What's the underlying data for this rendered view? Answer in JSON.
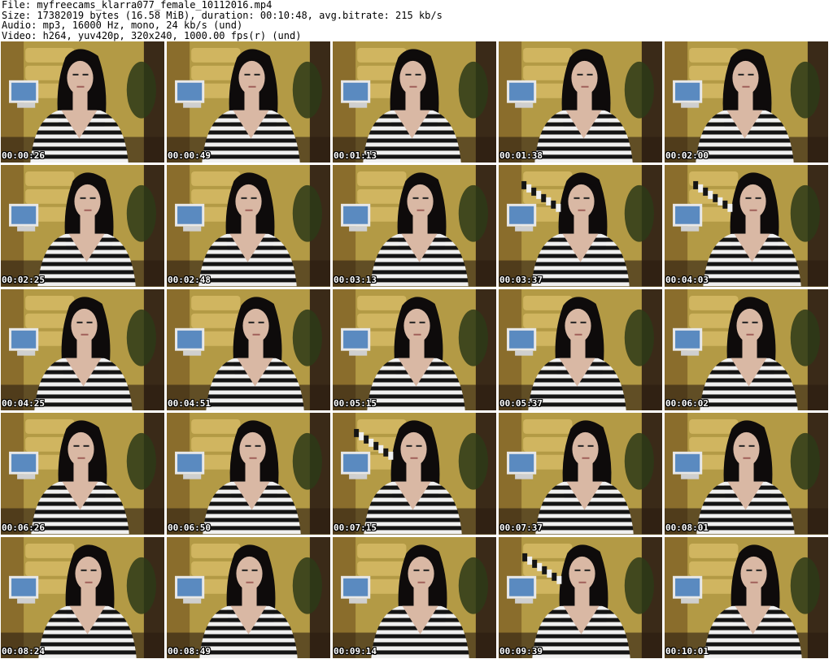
{
  "header": {
    "file_line": "File: myfreecams_klarra077_female_10112016.mp4",
    "size_line": "Size: 17382019 bytes (16.58 MiB), duration: 00:10:48, avg.bitrate: 215 kb/s",
    "audio_line": "Audio: mp3, 16000 Hz, mono, 24 kb/s (und)",
    "video_line": "Video: h264, yuv420p, 320x240, 1000.00 fps(r) (und)"
  },
  "thumbnails": [
    {
      "timestamp": "00:00:26"
    },
    {
      "timestamp": "00:00:49"
    },
    {
      "timestamp": "00:01:13"
    },
    {
      "timestamp": "00:01:38"
    },
    {
      "timestamp": "00:02:00"
    },
    {
      "timestamp": "00:02:25"
    },
    {
      "timestamp": "00:02:48"
    },
    {
      "timestamp": "00:03:13"
    },
    {
      "timestamp": "00:03:37"
    },
    {
      "timestamp": "00:04:03"
    },
    {
      "timestamp": "00:04:25"
    },
    {
      "timestamp": "00:04:51"
    },
    {
      "timestamp": "00:05:15"
    },
    {
      "timestamp": "00:05:37"
    },
    {
      "timestamp": "00:06:02"
    },
    {
      "timestamp": "00:06:26"
    },
    {
      "timestamp": "00:06:50"
    },
    {
      "timestamp": "00:07:15"
    },
    {
      "timestamp": "00:07:37"
    },
    {
      "timestamp": "00:08:01"
    },
    {
      "timestamp": "00:08:24"
    },
    {
      "timestamp": "00:08:49"
    },
    {
      "timestamp": "00:09:14"
    },
    {
      "timestamp": "00:09:39"
    },
    {
      "timestamp": "00:10:01"
    }
  ],
  "colors": {
    "background": "#ffffff",
    "header_text": "#000000",
    "timestamp_text": "#ffffff",
    "timestamp_outline": "#000000",
    "wall": "#b39a45",
    "panel": "#d9bd6a",
    "stripe_dark": "#141414",
    "stripe_light": "#f0f0f0",
    "hair": "#0e0b0b",
    "skin": "#d9b8a4"
  }
}
